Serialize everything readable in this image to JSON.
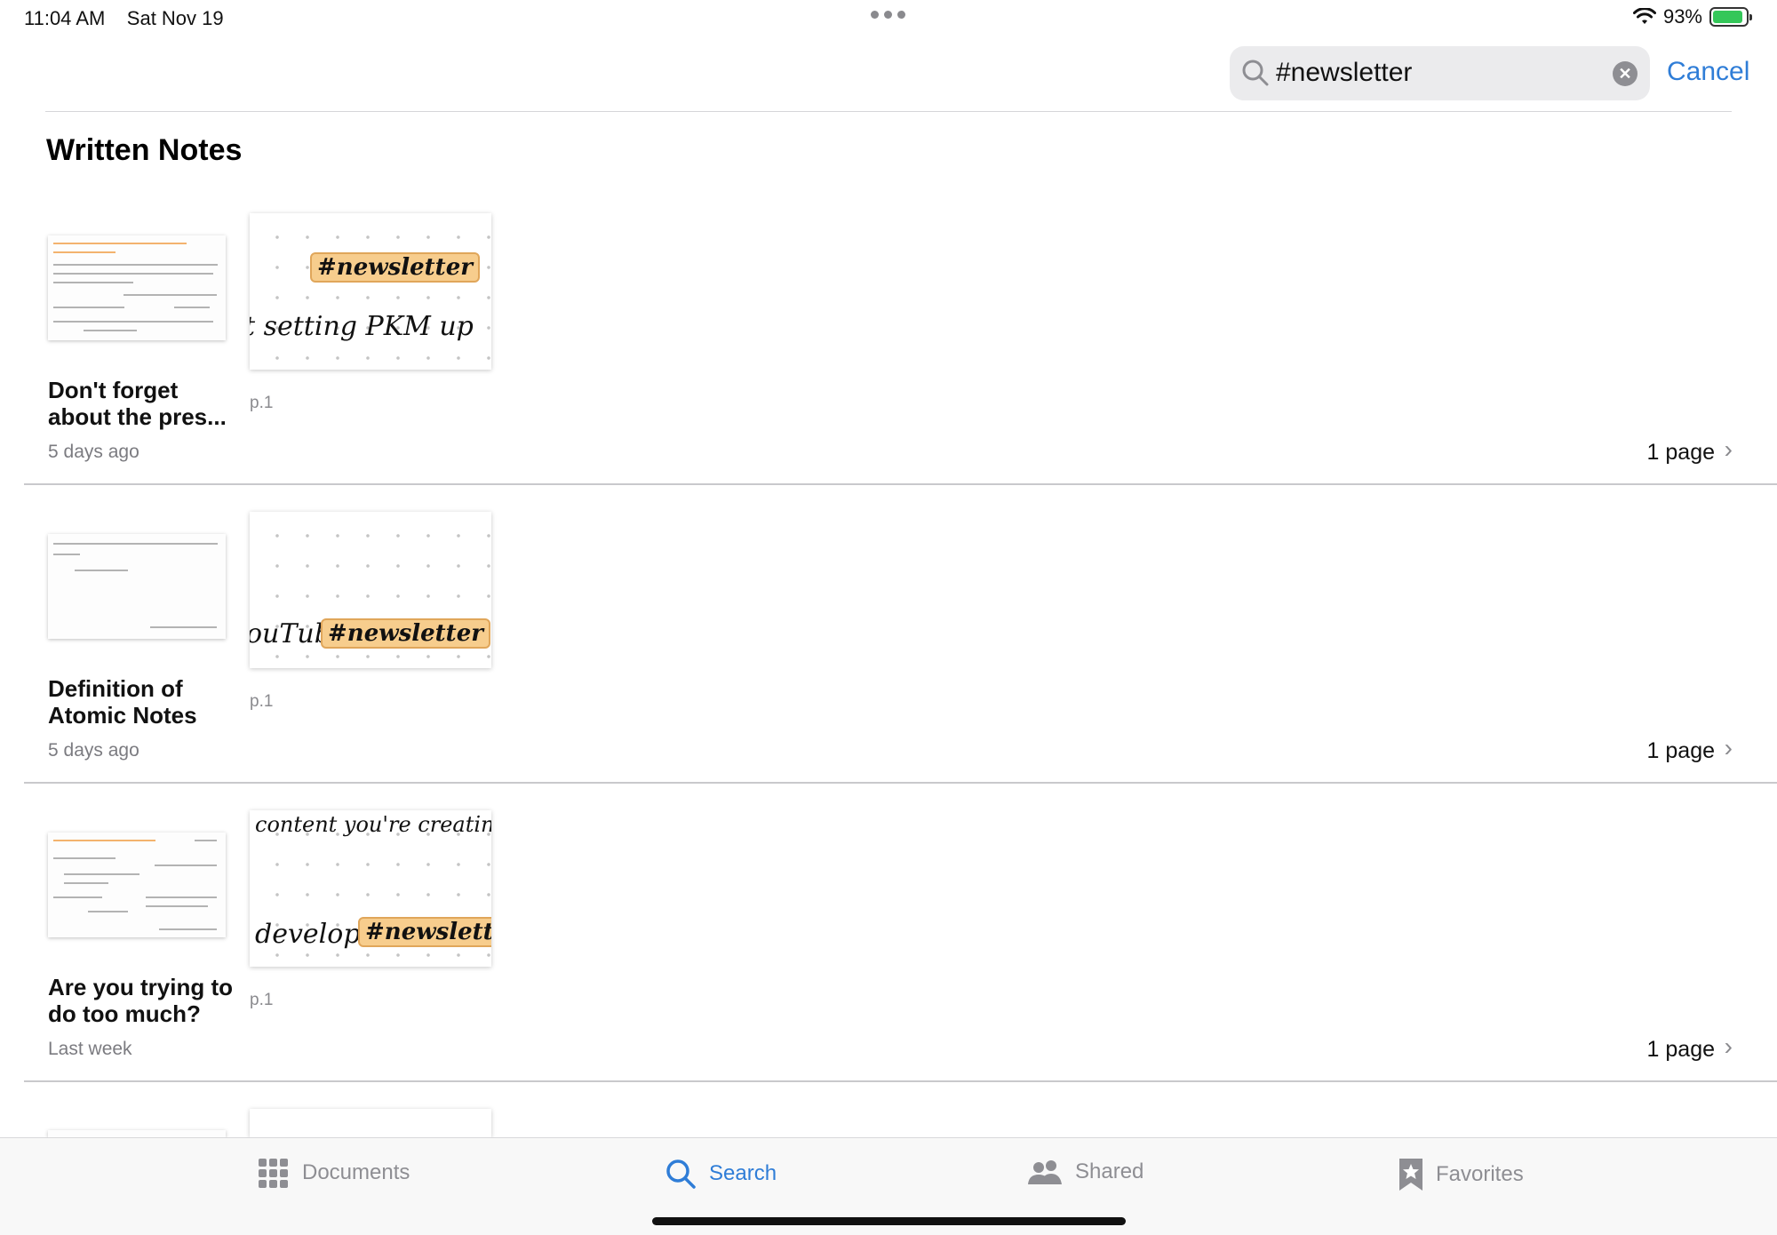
{
  "status_bar": {
    "time": "11:04 AM",
    "date": "Sat Nov 19",
    "battery": "93%",
    "battery_level": 0.93
  },
  "search": {
    "query": "#newsletter",
    "cancel_label": "Cancel"
  },
  "section_title": "Written Notes",
  "results": [
    {
      "title": "Don't forget about the pres...",
      "date": "5 days ago",
      "page_label": "p.1",
      "page_count": "1 page",
      "snippet_lines": [
        "t setting PKM up"
      ],
      "tag": "#newsletter"
    },
    {
      "title": "Definition of Atomic Notes",
      "date": "5 days ago",
      "page_label": "p.1",
      "page_count": "1 page",
      "snippet_lines": [
        "ouTube"
      ],
      "tag": "#newsletter"
    },
    {
      "title": "Are you trying to do too much?",
      "date": "Last week",
      "page_label": "p.1",
      "page_count": "1 page",
      "snippet_lines": [
        "content you're creating",
        "develop"
      ],
      "tag": "#newsletter"
    }
  ],
  "tab_bar": {
    "tabs": [
      {
        "label": "Documents",
        "icon": "grid-icon",
        "active": false
      },
      {
        "label": "Search",
        "icon": "search-icon",
        "active": true
      },
      {
        "label": "Shared",
        "icon": "people-icon",
        "active": false
      },
      {
        "label": "Favorites",
        "icon": "bookmark-star-icon",
        "active": false
      }
    ]
  },
  "colors": {
    "accent": "#2f7dd7",
    "tag_highlight": "#f7cd8d",
    "battery_green": "#34c759"
  }
}
